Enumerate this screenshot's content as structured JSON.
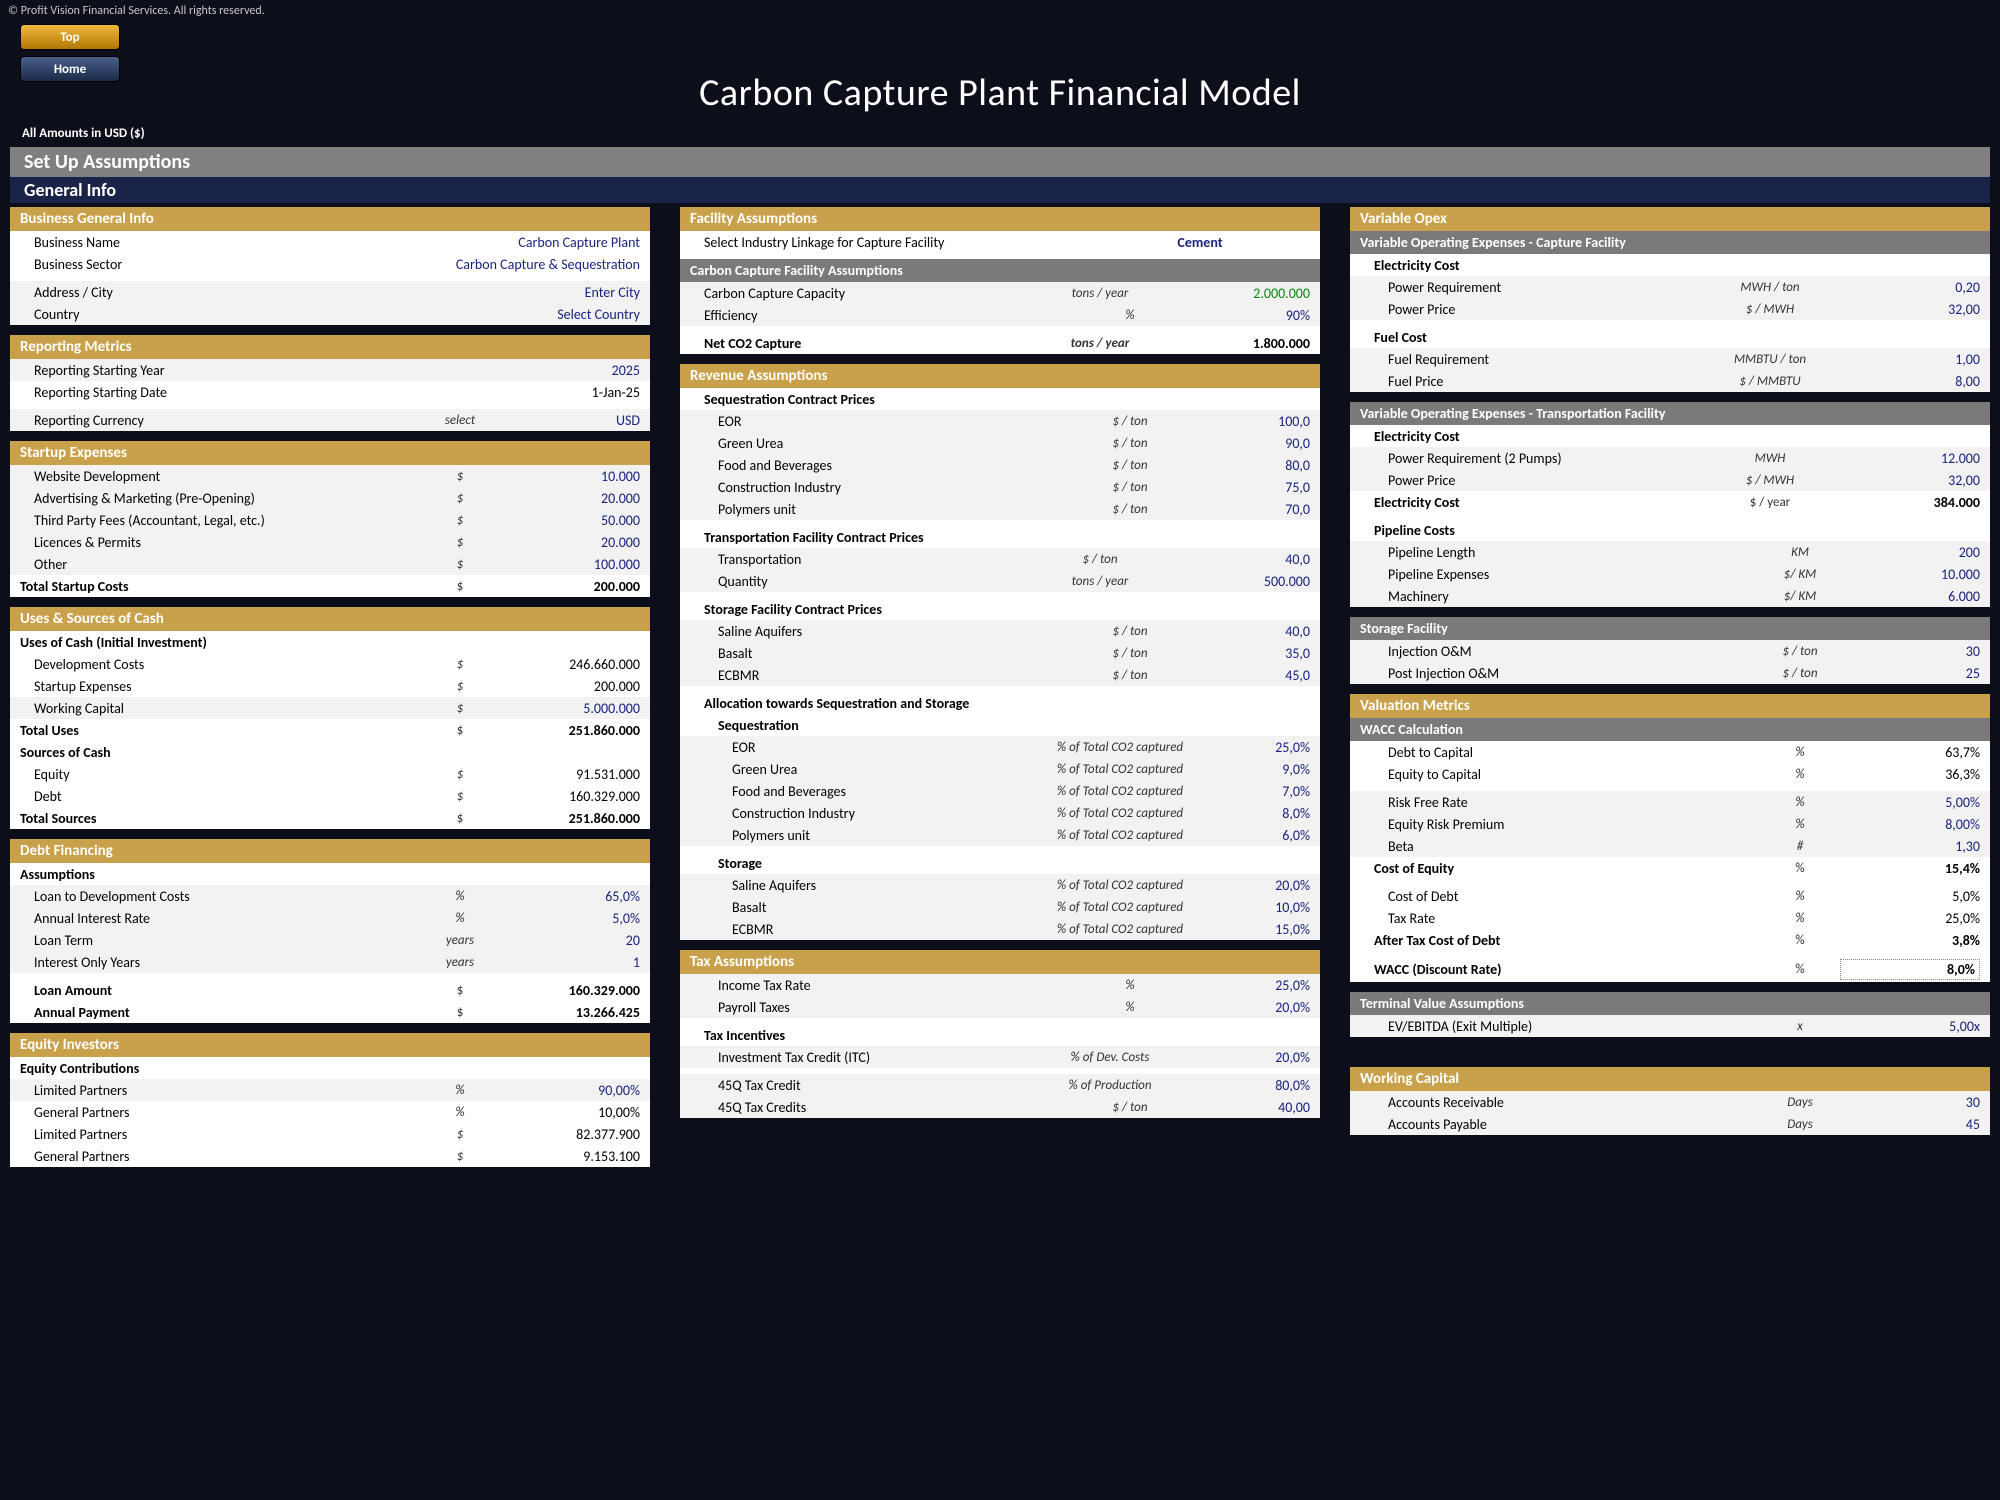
{
  "meta": {
    "copyright": "© Profit Vision Financial Services. All rights reserved."
  },
  "nav": {
    "top": "Top",
    "home": "Home"
  },
  "title": "Carbon Capture Plant Financial Model",
  "amounts_note": "All Amounts in  USD ($)",
  "bands": {
    "setup": "Set Up Assumptions",
    "general": "General Info"
  },
  "c1": {
    "bgi_hdr": "Business General Info",
    "business_name_lbl": "Business Name",
    "business_name_val": "Carbon Capture Plant",
    "sector_lbl": "Business Sector",
    "sector_val": "Carbon Capture & Sequestration",
    "address_lbl": "Address / City",
    "address_val": "Enter City",
    "country_lbl": "Country",
    "country_val": "Select Country",
    "rpt_hdr": "Reporting Metrics",
    "rpt_year_lbl": "Reporting Starting Year",
    "rpt_year_val": "2025",
    "rpt_date_lbl": "Reporting Starting Date",
    "rpt_date_val": "1-Jan-25",
    "rpt_curr_lbl": "Reporting Currency",
    "rpt_curr_unit": "select",
    "rpt_curr_val": "USD",
    "sx_hdr": "Startup Expenses",
    "sx1_lbl": "Website Development",
    "sx1_u": "$",
    "sx1_v": "10.000",
    "sx2_lbl": "Advertising & Marketing (Pre-Opening)",
    "sx2_u": "$",
    "sx2_v": "20.000",
    "sx3_lbl": "Third Party Fees (Accountant, Legal, etc.)",
    "sx3_u": "$",
    "sx3_v": "50.000",
    "sx4_lbl": "Licences & Permits",
    "sx4_u": "$",
    "sx4_v": "20.000",
    "sx5_lbl": "Other",
    "sx5_u": "$",
    "sx5_v": "100.000",
    "sxt_lbl": "Total Startup Costs",
    "sxt_u": "$",
    "sxt_v": "200.000",
    "us_hdr": "Uses & Sources of Cash",
    "uses_lbl": "Uses of Cash (Initial Investment)",
    "u1_lbl": "Development Costs",
    "u1_u": "$",
    "u1_v": "246.660.000",
    "u2_lbl": "Startup Expenses",
    "u2_u": "$",
    "u2_v": "200.000",
    "u3_lbl": "Working Capital",
    "u3_u": "$",
    "u3_v": "5.000.000",
    "ut_lbl": "Total Uses",
    "ut_u": "$",
    "ut_v": "251.860.000",
    "src_lbl": "Sources of Cash",
    "s1_lbl": "Equity",
    "s1_u": "$",
    "s1_v": "91.531.000",
    "s2_lbl": "Debt",
    "s2_u": "$",
    "s2_v": "160.329.000",
    "st_lbl": "Total Sources",
    "st_u": "$",
    "st_v": "251.860.000",
    "df_hdr": "Debt Financing",
    "df_ass_lbl": "Assumptions",
    "df1_lbl": "Loan to Development Costs",
    "df1_u": "%",
    "df1_v": "65,0%",
    "df2_lbl": "Annual Interest Rate",
    "df2_u": "%",
    "df2_v": "5,0%",
    "df3_lbl": "Loan Term",
    "df3_u": "years",
    "df3_v": "20",
    "df4_lbl": "Interest Only Years",
    "df4_u": "years",
    "df4_v": "1",
    "df5_lbl": "Loan Amount",
    "df5_u": "$",
    "df5_v": "160.329.000",
    "df6_lbl": "Annual Payment",
    "df6_u": "$",
    "df6_v": "13.266.425",
    "ei_hdr": "Equity Investors",
    "ec_lbl": "Equity Contributions",
    "ec1_lbl": "Limited Partners",
    "ec1_u": "%",
    "ec1_v": "90,00%",
    "ec2_lbl": "General Partners",
    "ec2_u": "%",
    "ec2_v": "10,00%",
    "ec3_lbl": "Limited Partners",
    "ec3_u": "$",
    "ec3_v": "82.377.900",
    "ec4_lbl": "General Partners",
    "ec4_u": "$",
    "ec4_v": "9.153.100"
  },
  "c2": {
    "fa_hdr": "Facility Assumptions",
    "fa_sel_lbl": "Select Industry Linkage for Capture Facility",
    "fa_sel_val": "Cement",
    "ccfa_hdr": "Carbon Capture Facility Assumptions",
    "cap_lbl": "Carbon Capture Capacity",
    "cap_u": "tons / year",
    "cap_v": "2.000.000",
    "eff_lbl": "Efficiency",
    "eff_u": "%",
    "eff_v": "90%",
    "net_lbl": "Net CO2 Capture",
    "net_u": "tons / year",
    "net_v": "1.800.000",
    "rev_hdr": "Revenue Assumptions",
    "seq_lbl": "Sequestration Contract Prices",
    "r1_lbl": "EOR",
    "r1_u": "$ / ton",
    "r1_v": "100,0",
    "r2_lbl": "Green Urea",
    "r2_u": "$ / ton",
    "r2_v": "90,0",
    "r3_lbl": "Food and Beverages",
    "r3_u": "$ / ton",
    "r3_v": "80,0",
    "r4_lbl": "Construction Industry",
    "r4_u": "$ / ton",
    "r4_v": "75,0",
    "r5_lbl": "Polymers unit",
    "r5_u": "$ / ton",
    "r5_v": "70,0",
    "tfcp_lbl": "Transportation Facility Contract Prices",
    "t1_lbl": "Transportation",
    "t1_u": "$ / ton",
    "t1_v": "40,0",
    "t2_lbl": "Quantity",
    "t2_u": "tons / year",
    "t2_v": "500.000",
    "sfcp_lbl": "Storage Facility Contract Prices",
    "sf1_lbl": "Saline Aquifers",
    "sf1_u": "$ / ton",
    "sf1_v": "40,0",
    "sf2_lbl": "Basalt",
    "sf2_u": "$ / ton",
    "sf2_v": "35,0",
    "sf3_lbl": "ECBMR",
    "sf3_u": "$ / ton",
    "sf3_v": "45,0",
    "alloc_lbl": "Allocation towards Sequestration and Storage",
    "alloc_seq_lbl": "Sequestration",
    "a1_lbl": "EOR",
    "a1_u": "% of Total CO2 captured",
    "a1_v": "25,0%",
    "a2_lbl": "Green Urea",
    "a2_u": "% of Total CO2 captured",
    "a2_v": "9,0%",
    "a3_lbl": "Food and Beverages",
    "a3_u": "% of Total CO2 captured",
    "a3_v": "7,0%",
    "a4_lbl": "Construction Industry",
    "a4_u": "% of Total CO2 captured",
    "a4_v": "8,0%",
    "a5_lbl": "Polymers unit",
    "a5_u": "% of Total CO2 captured",
    "a5_v": "6,0%",
    "alloc_sto_lbl": "Storage",
    "as1_lbl": "Saline Aquifers",
    "as1_u": "% of Total CO2 captured",
    "as1_v": "20,0%",
    "as2_lbl": "Basalt",
    "as2_u": "% of Total CO2 captured",
    "as2_v": "10,0%",
    "as3_lbl": "ECBMR",
    "as3_u": "% of Total CO2 captured",
    "as3_v": "15,0%",
    "tax_hdr": "Tax Assumptions",
    "tx1_lbl": "Income Tax Rate",
    "tx1_u": "%",
    "tx1_v": "25,0%",
    "tx2_lbl": "Payroll Taxes",
    "tx2_u": "%",
    "tx2_v": "20,0%",
    "ti_lbl": "Tax Incentives",
    "ti1_lbl": "Investment Tax Credit (ITC)",
    "ti1_u": "% of Dev. Costs",
    "ti1_v": "20,0%",
    "ti2_lbl": "45Q Tax Credit",
    "ti2_u": "% of Production",
    "ti2_v": "80,0%",
    "ti3_lbl": "45Q Tax Credits",
    "ti3_u": "$ / ton",
    "ti3_v": "40,00"
  },
  "c3": {
    "vo_hdr": "Variable Opex",
    "vocf_hdr": "Variable Operating Expenses - Capture Facility",
    "ec_lbl": "Electricity Cost",
    "pr_lbl": "Power Requirement",
    "pr_u": "MWH / ton",
    "pr_v": "0,20",
    "pp_lbl": "Power Price",
    "pp_u": "$ / MWH",
    "pp_v": "32,00",
    "fc_lbl": "Fuel Cost",
    "fr_lbl": "Fuel Requirement",
    "fr_u": "MMBTU / ton",
    "fr_v": "1,00",
    "fp_lbl": "Fuel Price",
    "fp_u": "$ / MMBTU",
    "fp_v": "8,00",
    "votf_hdr": "Variable Operating Expenses - Transportation Facility",
    "ec2_lbl": "Electricity Cost",
    "pr2_lbl": "Power Requirement (2 Pumps)",
    "pr2_u": "MWH",
    "pr2_v": "12.000",
    "pp2_lbl": "Power Price",
    "pp2_u": "$ / MWH",
    "pp2_v": "32,00",
    "ect_lbl": "Electricity Cost",
    "ect_u": "$ / year",
    "ect_v": "384.000",
    "pc_lbl": "Pipeline Costs",
    "pl_lbl": "Pipeline Length",
    "pl_u": "KM",
    "pl_v": "200",
    "pe_lbl": "Pipeline Expenses",
    "pe_u": "$/ KM",
    "pe_v": "10.000",
    "mc_lbl": "Machinery",
    "mc_u": "$/ KM",
    "mc_v": "6.000",
    "sf_hdr": "Storage Facility",
    "iom_lbl": "Injection O&M",
    "iom_u": "$ / ton",
    "iom_v": "30",
    "piom_lbl": "Post Injection O&M",
    "piom_u": "$ / ton",
    "piom_v": "25",
    "vm_hdr": "Valuation Metrics",
    "wacc_hdr": "WACC Calculation",
    "dtc_lbl": "Debt to Capital",
    "dtc_u": "%",
    "dtc_v": "63,7%",
    "etc_lbl": "Equity to Capital",
    "etc_u": "%",
    "etc_v": "36,3%",
    "rfr_lbl": "Risk Free Rate",
    "rfr_u": "%",
    "rfr_v": "5,00%",
    "erp_lbl": "Equity Risk Premium",
    "erp_u": "%",
    "erp_v": "8,00%",
    "beta_lbl": "Beta",
    "beta_u": "#",
    "beta_v": "1,30",
    "coe_lbl": "Cost of Equity",
    "coe_u": "%",
    "coe_v": "15,4%",
    "cod_lbl": "Cost of Debt",
    "cod_u": "%",
    "cod_v": "5,0%",
    "tr_lbl": "Tax Rate",
    "tr_u": "%",
    "tr_v": "25,0%",
    "atcd_lbl": "After Tax Cost of Debt",
    "atcd_u": "%",
    "atcd_v": "3,8%",
    "wacc_lbl": "WACC (Discount Rate)",
    "wacc_u": "%",
    "wacc_v": "8,0%",
    "tva_hdr": "Terminal Value Assumptions",
    "ev_lbl": "EV/EBITDA (Exit Multiple)",
    "ev_u": "x",
    "ev_v": "5,00x",
    "wc_hdr": "Working Capital",
    "ar_lbl": "Accounts Receivable",
    "ar_u": "Days",
    "ar_v": "30",
    "ap_lbl": "Accounts Payable",
    "ap_u": "Days",
    "ap_v": "45"
  }
}
